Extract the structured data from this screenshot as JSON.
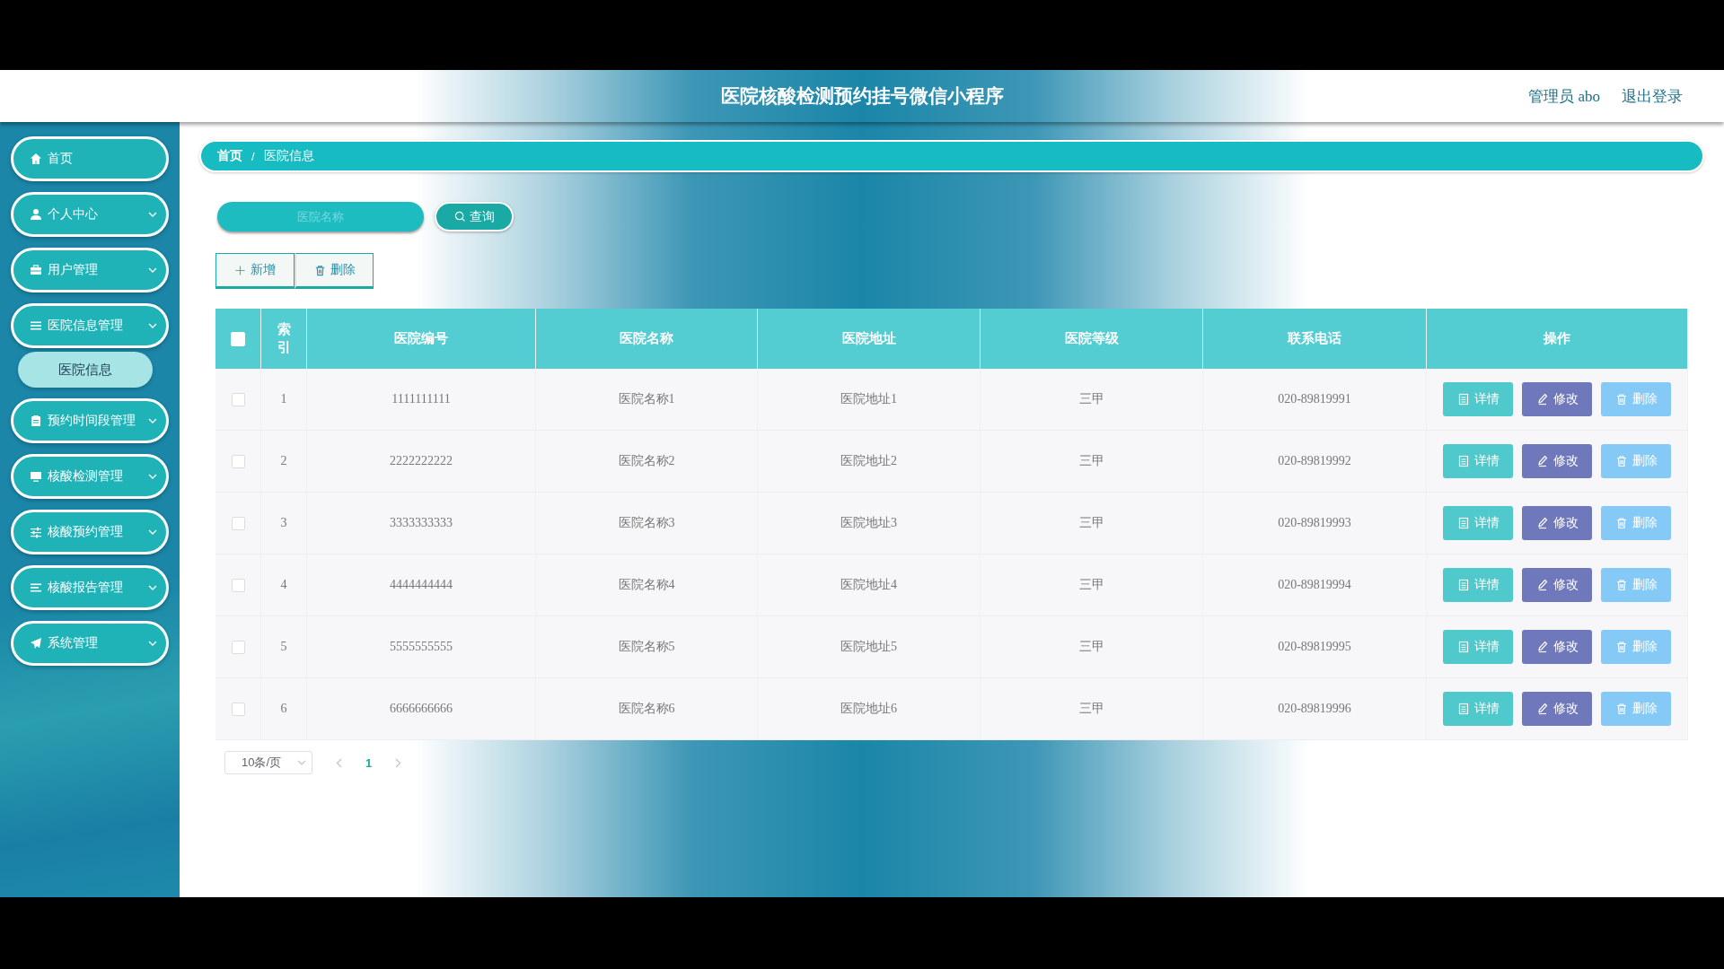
{
  "header": {
    "title": "医院核酸检测预约挂号微信小程序",
    "user": "管理员 abo",
    "logout": "退出登录"
  },
  "sidebar": {
    "items": [
      {
        "label": "首页",
        "has_submenu": false
      },
      {
        "label": "个人中心",
        "has_submenu": true
      },
      {
        "label": "用户管理",
        "has_submenu": true
      },
      {
        "label": "医院信息管理",
        "has_submenu": true,
        "children": [
          {
            "label": "医院信息",
            "selected": true
          }
        ]
      },
      {
        "label": "预约时间段管理",
        "has_submenu": true
      },
      {
        "label": "核酸检测管理",
        "has_submenu": true
      },
      {
        "label": "核酸预约管理",
        "has_submenu": true
      },
      {
        "label": "核酸报告管理",
        "has_submenu": true
      },
      {
        "label": "系统管理",
        "has_submenu": true
      }
    ]
  },
  "breadcrumb": {
    "separator": "/",
    "items": [
      "首页",
      "医院信息"
    ]
  },
  "search": {
    "placeholder": "医院名称",
    "button": "查询"
  },
  "toolbar": [
    {
      "kind": "add",
      "label": "新增"
    },
    {
      "kind": "delete",
      "label": "删除"
    }
  ],
  "table": {
    "header_checked": false,
    "columns": [
      "索引",
      "医院编号",
      "医院名称",
      "医院地址",
      "医院等级",
      "联系电话",
      "操作"
    ],
    "rows": [
      {
        "checked": false,
        "cells": [
          "1",
          "1111111111",
          "医院名称1",
          "医院地址1",
          "三甲",
          "020-89819991"
        ],
        "actions": [
          {
            "kind": "detail",
            "label": "详情"
          },
          {
            "kind": "edit",
            "label": "修改"
          },
          {
            "kind": "delete",
            "label": "删除"
          }
        ]
      },
      {
        "checked": false,
        "cells": [
          "2",
          "2222222222",
          "医院名称2",
          "医院地址2",
          "三甲",
          "020-89819992"
        ],
        "actions": [
          {
            "kind": "detail",
            "label": "详情"
          },
          {
            "kind": "edit",
            "label": "修改"
          },
          {
            "kind": "delete",
            "label": "删除"
          }
        ]
      },
      {
        "checked": false,
        "cells": [
          "3",
          "3333333333",
          "医院名称3",
          "医院地址3",
          "三甲",
          "020-89819993"
        ],
        "actions": [
          {
            "kind": "detail",
            "label": "详情"
          },
          {
            "kind": "edit",
            "label": "修改"
          },
          {
            "kind": "delete",
            "label": "删除"
          }
        ]
      },
      {
        "checked": false,
        "cells": [
          "4",
          "4444444444",
          "医院名称4",
          "医院地址4",
          "三甲",
          "020-89819994"
        ],
        "actions": [
          {
            "kind": "detail",
            "label": "详情"
          },
          {
            "kind": "edit",
            "label": "修改"
          },
          {
            "kind": "delete",
            "label": "删除"
          }
        ]
      },
      {
        "checked": false,
        "cells": [
          "5",
          "5555555555",
          "医院名称5",
          "医院地址5",
          "三甲",
          "020-89819995"
        ],
        "actions": [
          {
            "kind": "detail",
            "label": "详情"
          },
          {
            "kind": "edit",
            "label": "修改"
          },
          {
            "kind": "delete",
            "label": "删除"
          }
        ]
      },
      {
        "checked": false,
        "cells": [
          "6",
          "6666666666",
          "医院名称6",
          "医院地址6",
          "三甲",
          "020-89819996"
        ],
        "actions": [
          {
            "kind": "detail",
            "label": "详情"
          },
          {
            "kind": "edit",
            "label": "修改"
          },
          {
            "kind": "delete",
            "label": "删除"
          }
        ]
      }
    ]
  },
  "pagination": {
    "page_size": "10条/页",
    "pages": [
      {
        "label": "1",
        "selected": true
      }
    ]
  }
}
